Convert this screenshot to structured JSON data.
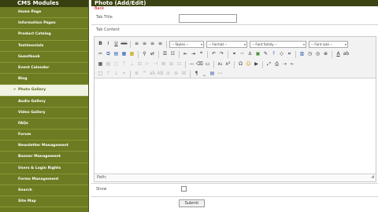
{
  "sidebar": {
    "title": "CMS Modules",
    "items": [
      {
        "label": "Home Page"
      },
      {
        "label": "Information Pages"
      },
      {
        "label": "Product Catalog"
      },
      {
        "label": "Testimonials"
      },
      {
        "label": "Guestbook"
      },
      {
        "label": "Event Calendar"
      },
      {
        "label": "Blog"
      },
      {
        "label": "Photo Gallery"
      },
      {
        "label": "Audio Gallery"
      },
      {
        "label": "Video Gallery"
      },
      {
        "label": "FAQs"
      },
      {
        "label": "Forum"
      },
      {
        "label": "Newsletter Management"
      },
      {
        "label": "Banner Management"
      },
      {
        "label": "Users & Login Rights"
      },
      {
        "label": "Forms Management"
      },
      {
        "label": "Search"
      },
      {
        "label": "Site Map"
      }
    ],
    "active_index": 7,
    "arrow_glyph": "»"
  },
  "main": {
    "title": "Photo (Add/Edit)",
    "back_label": "Back",
    "tab_title_label": "Tab Title",
    "tab_title_value": "",
    "tab_content_label": "Tab Content",
    "path_label": "Path:",
    "show_label": "Show",
    "submit_label": "Submit"
  },
  "toolbar": {
    "row1": [
      "B",
      "I",
      "U",
      "ABC",
      "≡",
      "≡",
      "≡",
      "≡"
    ],
    "styles_select": "-- Styles --",
    "format_select": "-- Format --",
    "font_family_select": "-- Font family --",
    "font_size_select": "-- Font size --"
  },
  "colors": {
    "sidebar_bg": "#6d7b22",
    "sidebar_header": "#384010",
    "active_item_bg": "#f1f3e3",
    "back_link": "#cc0000"
  }
}
